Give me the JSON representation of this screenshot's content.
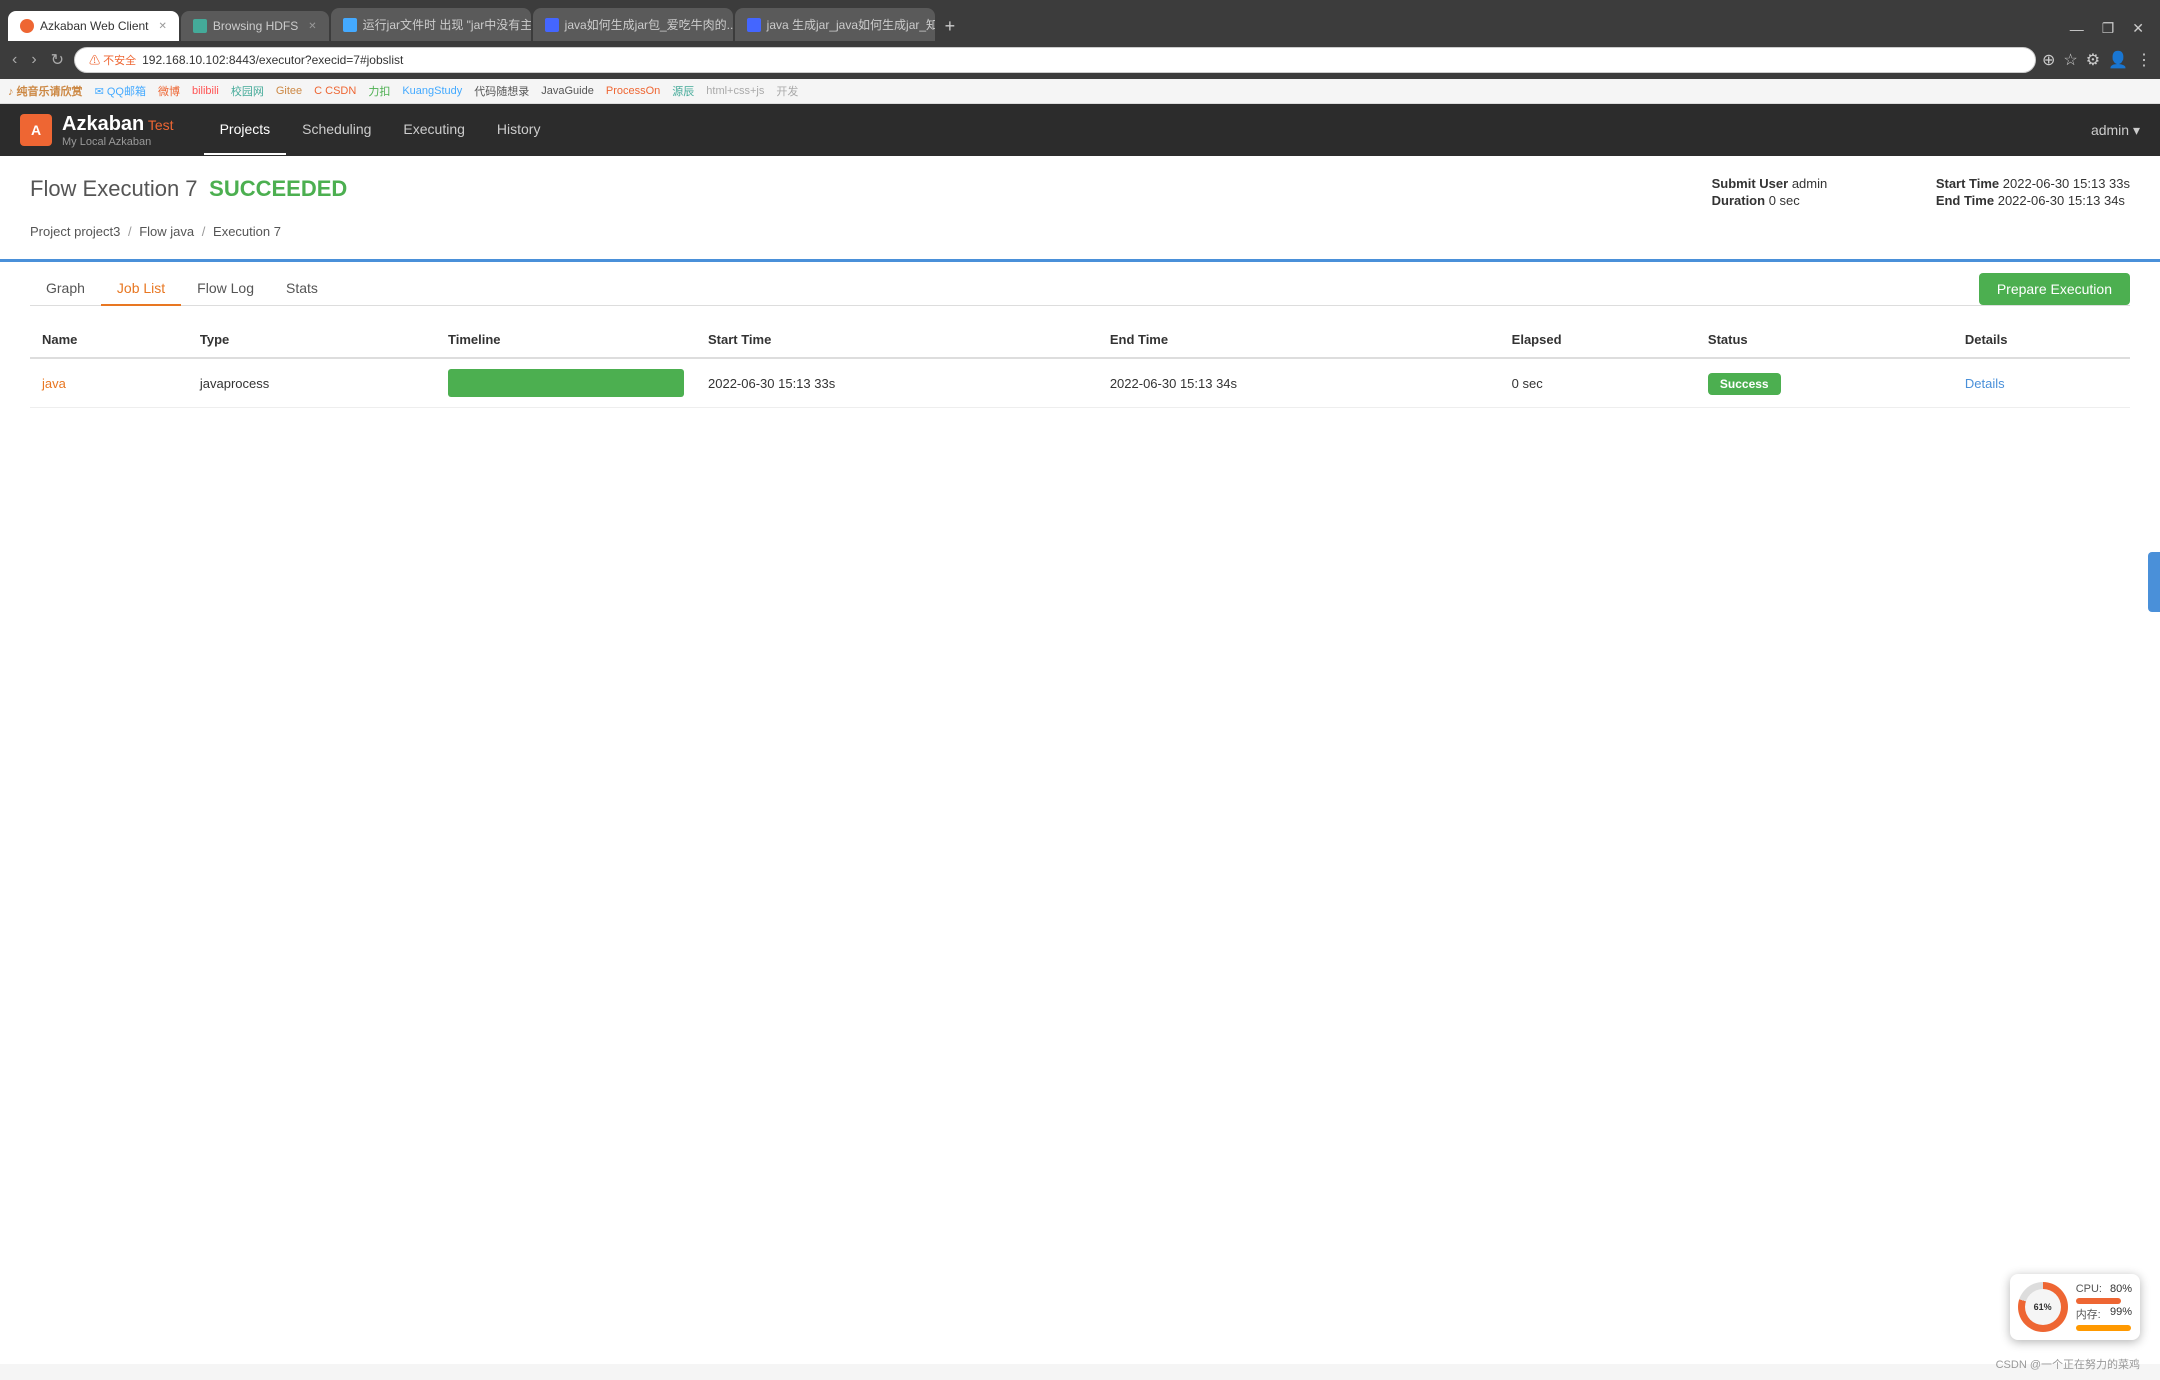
{
  "browser": {
    "tabs": [
      {
        "id": "tab1",
        "label": "Azkaban Web Client",
        "favicon_type": "azkaban",
        "active": true
      },
      {
        "id": "tab2",
        "label": "Browsing HDFS",
        "favicon_type": "hdfs",
        "active": false
      },
      {
        "id": "tab3",
        "label": "运行jar文件时 出现 \"jar中没有主...",
        "favicon_type": "blue1",
        "active": false
      },
      {
        "id": "tab4",
        "label": "java如何生成jar包_爱吃牛肉的...",
        "favicon_type": "blue2",
        "active": false
      },
      {
        "id": "tab5",
        "label": "java 生成jar_java如何生成jar_知...",
        "favicon_type": "blue3",
        "active": false
      }
    ],
    "address": "192.168.10.102:8443/executor?execid=7#jobslist",
    "warning_text": "不安全"
  },
  "bookmarks": [
    {
      "label": "纯音乐请欣赏",
      "color": "#e63"
    },
    {
      "label": "QQ邮箱",
      "color": "#4af"
    },
    {
      "label": "微博",
      "color": "#e63"
    },
    {
      "label": "bilibili",
      "color": "#f55"
    },
    {
      "label": "校园网",
      "color": "#4a9"
    },
    {
      "label": "Gitee",
      "color": "#c84"
    },
    {
      "label": "CSDN",
      "color": "#e63"
    },
    {
      "label": "力扣",
      "color": "#4caf50"
    },
    {
      "label": "KuangStudy",
      "color": "#4af"
    },
    {
      "label": "代码随想录",
      "color": "#555"
    },
    {
      "label": "JavaGuide",
      "color": "#555"
    },
    {
      "label": "ProcessOn",
      "color": "#e63"
    },
    {
      "label": "源辰",
      "color": "#4a9"
    },
    {
      "label": "html+css+js",
      "color": "#aaa"
    },
    {
      "label": "开发",
      "color": "#aaa"
    }
  ],
  "nav": {
    "logo_text": "Azkaban",
    "logo_test": "Test",
    "logo_sub": "My Local Azkaban",
    "links": [
      "Projects",
      "Scheduling",
      "Executing",
      "History"
    ],
    "active_link": "Projects",
    "user": "admin"
  },
  "page": {
    "title_prefix": "Flow Execution 7",
    "status": "SUCCEEDED",
    "submit_label": "Submit User",
    "submit_value": "admin",
    "duration_label": "Duration",
    "duration_value": "0 sec",
    "start_time_label": "Start Time",
    "start_time_value": "2022-06-30 15:13 33s",
    "end_time_label": "End Time",
    "end_time_value": "2022-06-30 15:13 34s"
  },
  "breadcrumb": {
    "project_label": "Project",
    "project_value": "project3",
    "flow_label": "Flow",
    "flow_value": "java",
    "execution_label": "Execution 7"
  },
  "tabs": {
    "items": [
      "Graph",
      "Job List",
      "Flow Log",
      "Stats"
    ],
    "active": "Job List"
  },
  "prepare_btn": "Prepare Execution",
  "table": {
    "columns": [
      "Name",
      "Type",
      "Timeline",
      "Start Time",
      "End Time",
      "Elapsed",
      "Status",
      "Details"
    ],
    "rows": [
      {
        "name": "java",
        "type": "javaprocess",
        "timeline_pct": 100,
        "start_time": "2022-06-30 15:13 33s",
        "end_time": "2022-06-30 15:13 34s",
        "elapsed": "0 sec",
        "status": "Success",
        "details": "Details"
      }
    ]
  },
  "sys_monitor": {
    "cpu_label": "CPU:",
    "cpu_value": "80%",
    "mem_label": "内存:",
    "mem_value": "99%",
    "gauge_label": "61%"
  },
  "footer": "CSDN @一个正在努力的菜鸡"
}
